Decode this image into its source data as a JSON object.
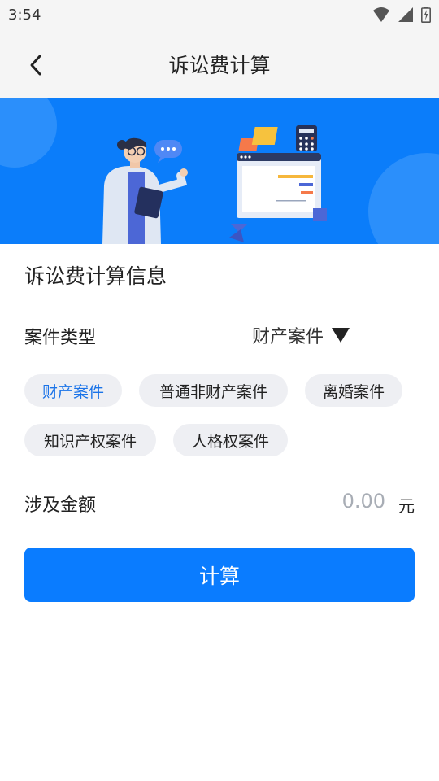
{
  "status_bar": {
    "time": "3:54",
    "icons": [
      "wifi-icon",
      "signal-icon",
      "battery-icon"
    ]
  },
  "header": {
    "title": "诉讼费计算",
    "back_icon": "back-arrow-icon"
  },
  "banner": {
    "illustration": "person-pointing-at-screen-with-calculator",
    "background_color": "#0b7dfa"
  },
  "form": {
    "section_title": "诉讼费计算信息",
    "case_type": {
      "label": "案件类型",
      "selected": "财产案件",
      "dropdown_icon": "triangle-down-icon",
      "options": [
        "财产案件",
        "普通非财产案件",
        "离婚案件",
        "知识产权案件",
        "人格权案件"
      ],
      "active_index": 0
    },
    "amount": {
      "label": "涉及金额",
      "placeholder": "0.00",
      "unit": "元"
    },
    "submit_label": "计算"
  },
  "colors": {
    "accent": "#0a7cff",
    "chip_active_text": "#1a73e8",
    "chip_background": "#eeeff3",
    "header_background": "#f5f5f5"
  }
}
